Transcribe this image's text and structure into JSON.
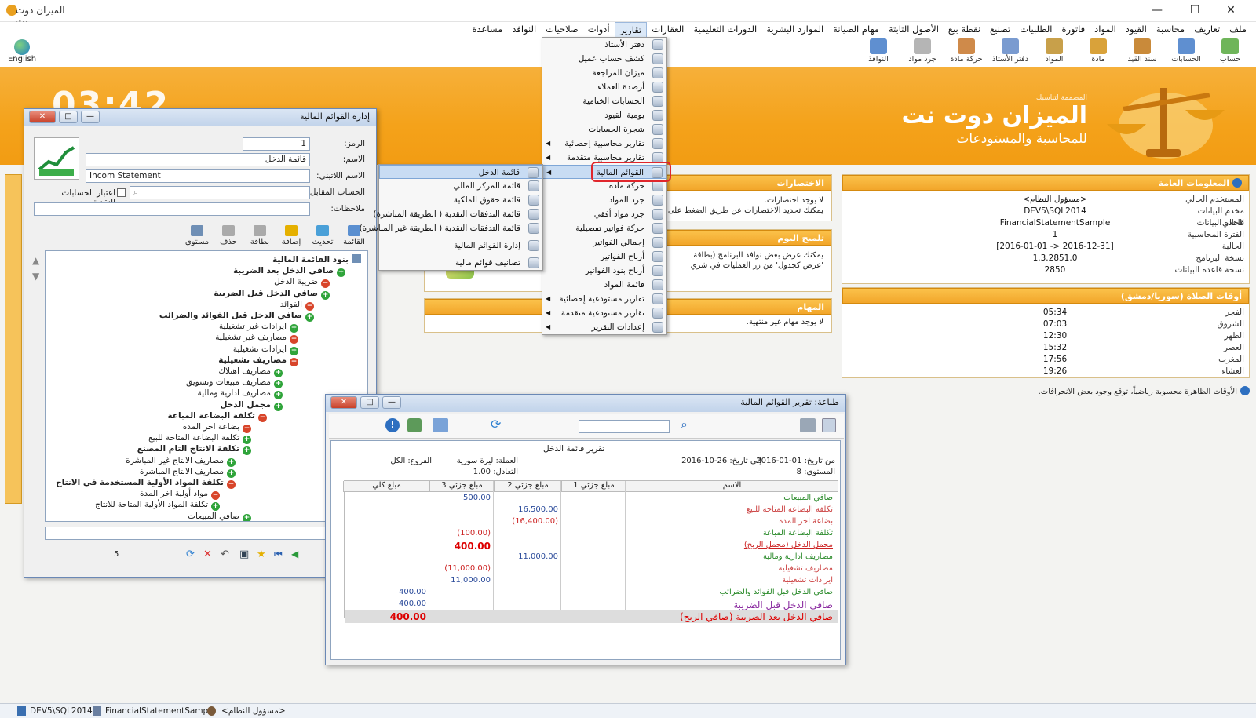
{
  "app": {
    "title": "الميزان دوت نت",
    "language_button": "English"
  },
  "menubar": [
    "ملف",
    "تعاريف",
    "محاسبة",
    "القيود",
    "المواد",
    "فاتورة",
    "الطلبيات",
    "تصنيع",
    "نقطة بيع",
    "الأصول الثابتة",
    "مهام الصيانة",
    "الموارد البشرية",
    "الدورات التعليمية",
    "العقارات",
    "تقارير",
    "أدوات",
    "صلاحيات",
    "النوافذ",
    "مساعدة"
  ],
  "toolbar": [
    "حساب",
    "الحسابات",
    "سند القيد",
    "مادة",
    "المواد",
    "دفتر الأستاذ",
    "حركة مادة",
    "جرد مواد",
    "النوافذ"
  ],
  "banner": {
    "clock": "03:42",
    "company_small": "المصممة لتناسبك",
    "brand": "الميزان دوت نت",
    "tagline": "للمحاسبة والمستودعات"
  },
  "general_info": {
    "title": "المعلومات العامة",
    "rows": [
      {
        "k": "المستخدم الحالي",
        "v": "<مسؤول النظام>"
      },
      {
        "k": "مخدم البيانات الحالي",
        "v": "DEV5\\SQL2014"
      },
      {
        "k": "قاعدة البيانات",
        "v": "FinancialStatementSample"
      },
      {
        "k": "الفترة المحاسبية الحالية",
        "v": "1"
      },
      {
        "k": "",
        "v": "[2016-12-31 <- 2016-01-01]"
      },
      {
        "k": "نسخة البرنامج",
        "v": "1.3.2851.0"
      },
      {
        "k": "نسخة قاعدة البيانات",
        "v": "2850"
      }
    ]
  },
  "prayer": {
    "title": "أوقات الصلاة (سوريا/دمشق)",
    "rows": [
      {
        "k": "الفجر",
        "v": "05:34"
      },
      {
        "k": "الشروق",
        "v": "07:03"
      },
      {
        "k": "الظهر",
        "v": "12:30"
      },
      {
        "k": "العصر",
        "v": "15:32"
      },
      {
        "k": "المغرب",
        "v": "17:56"
      },
      {
        "k": "العشاء",
        "v": "19:26"
      }
    ],
    "note": "الأوقات الظاهرة محسوبة رياضياً، توقع وجود بعض الانحرافات."
  },
  "shortcuts": {
    "title": "الاختصارات",
    "line1": "لا يوجد اختصارات.",
    "line2": "يمكنك تحديد الاختصارات عن طريق الضغط على زر"
  },
  "tip": {
    "title": "تلميح اليوم",
    "line1": "يمكنك عرض بعض نوافذ البرنامج (بطاقة",
    "line2": "'عرض كجدول' من زر العمليات في شري"
  },
  "tasks": {
    "title": "المهام",
    "line1": "لا يوجد مهام غير منتهية."
  },
  "reports_menu": {
    "items": [
      "دفتر الأستاذ",
      "كشف حساب عميل",
      "ميزان المراجعة",
      "أرصدة العملاء",
      "الحسابات الختامية",
      "يومية القيود",
      "شجرة الحسابات",
      "تقارير محاسبية إحصائية",
      "تقارير محاسبية متقدمة",
      "القوائم المالية",
      "حركة مادة",
      "جرد المواد",
      "جرد مواد أفقي",
      "حركة فواتير تفصيلية",
      "إجمالي الفواتير",
      "أرباح الفواتير",
      "أرباح بنود الفواتير",
      "قائمة المواد",
      "تقارير مستودعية إحصائية",
      "تقارير مستودعية متقدمة",
      "إعدادات التقرير"
    ]
  },
  "submenu": {
    "items": [
      "قائمة الدخل",
      "قائمة المركز المالي",
      "قائمة حقوق الملكية",
      "قائمة التدفقات النقدية ( الطريقة المباشرة)",
      "قائمة التدفقات النقدية ( الطريقة غير المباشرة)",
      "إدارة القوائم المالية",
      "تصانيف قوائم مالية"
    ]
  },
  "fs_window": {
    "title": "إدارة القوائم المالية",
    "code_label": "الرمز:",
    "code_value": "1",
    "name_label": "الاسم:",
    "name_value": "قائمة الدخل",
    "latin_label": "الاسم اللاتيني:",
    "latin_value": "Incom Statement",
    "contra_label": "الحساب المقابل:",
    "cash_label": "اعتبار الحسابات النقدية",
    "notes_label": "ملاحظات:",
    "tools": [
      "القائمة",
      "تحديث",
      "إضافة",
      "بطاقة",
      "حذف",
      "مستوى"
    ],
    "tree": [
      {
        "t": "بنود القائمة المالية",
        "b": true,
        "i": ""
      },
      {
        "t": "صافي الدخل بعد الضريبة",
        "b": true,
        "i": "g"
      },
      {
        "t": "ضريبة الدخل",
        "b": false,
        "i": "r"
      },
      {
        "t": "صافي الدخل قبل الضريبة",
        "b": true,
        "i": "g"
      },
      {
        "t": "الفوائد",
        "b": false,
        "i": "r"
      },
      {
        "t": "صافي الدخل قبل الفوائد والضرائب",
        "b": true,
        "i": "g"
      },
      {
        "t": "ايرادات غير تشغيلية",
        "b": false,
        "i": "g"
      },
      {
        "t": "مصاريف غير تشغيلية",
        "b": false,
        "i": "r"
      },
      {
        "t": "ايرادات تشغيلية",
        "b": false,
        "i": "g"
      },
      {
        "t": "مصاريف تشغيلية",
        "b": true,
        "i": "r"
      },
      {
        "t": "مصاريف اهتلاك",
        "b": false,
        "i": "g"
      },
      {
        "t": "مصاريف مبيعات وتسويق",
        "b": false,
        "i": "g"
      },
      {
        "t": "مصاريف ادارية ومالية",
        "b": false,
        "i": "g"
      },
      {
        "t": "مجمل الدخل",
        "b": true,
        "i": "g"
      },
      {
        "t": "تكلفة البضاعة المباعة",
        "b": true,
        "i": "r"
      },
      {
        "t": "بضاعة اخر المدة",
        "b": false,
        "i": "r"
      },
      {
        "t": "تكلفة البضاعة المتاحة للبيع",
        "b": false,
        "i": "g"
      },
      {
        "t": "تكلفة الانتاج التام المصنع",
        "b": true,
        "i": "g"
      },
      {
        "t": "مصاريف الانتاج غير المباشرة",
        "b": false,
        "i": "g"
      },
      {
        "t": "مصاريف الانتاج المباشرة",
        "b": false,
        "i": "g"
      },
      {
        "t": "تكلفة المواد الأولية المستخدمة في الانتاج",
        "b": true,
        "i": "r"
      },
      {
        "t": "مواد أولية اخر المدة",
        "b": false,
        "i": "r"
      },
      {
        "t": "تكلفة المواد الأولية المتاحة للانتاج",
        "b": false,
        "i": "g"
      },
      {
        "t": "صافي المبيعات",
        "b": false,
        "i": "g"
      }
    ],
    "level": "5"
  },
  "print_window": {
    "title": "طباعة: تقرير القوائم المالية",
    "report_title": "تقرير قائمة الدخل",
    "from_label": "من تاريخ:",
    "from": "01-01-2016",
    "to_label": "إلى تاريخ:",
    "to": "26-10-2016",
    "level_label": "المستوى:",
    "level": "8",
    "currency_label": "العملة:",
    "currency": "ليرة سورية",
    "rate_label": "التعادل:",
    "rate": "1.00",
    "branches_label": "الفروع:",
    "branches": "الكل",
    "headers": [
      "الاسم",
      "مبلغ جزئي 1",
      "مبلغ جزئي 2",
      "مبلغ جزئي 3",
      "مبلغ كلي"
    ],
    "rows": [
      {
        "name": "صافي المبيعات",
        "p1": "",
        "p2": "",
        "p3": "500.00",
        "total": ""
      },
      {
        "name": "تكلفة البضاعة المتاحة للبيع",
        "p1": "",
        "p2": "16,500.00",
        "p3": "",
        "total": ""
      },
      {
        "name": "بضاعة اخر المدة",
        "p1": "",
        "p2": "(16,400.00)",
        "p3": "",
        "total": ""
      },
      {
        "name": "تكلفة البضاعة المباعة",
        "p1": "",
        "p2": "",
        "p3": "(100.00)",
        "total": ""
      },
      {
        "name": "مجمل الدخل (مجمل الربح)",
        "p1": "",
        "p2": "",
        "p3": "400.00",
        "total": ""
      },
      {
        "name": "مصاريف ادارية ومالية",
        "p1": "",
        "p2": "11,000.00",
        "p3": "",
        "total": ""
      },
      {
        "name": "مصاريف تشغيلية",
        "p1": "",
        "p2": "",
        "p3": "(11,000.00)",
        "total": ""
      },
      {
        "name": "ايرادات تشغيلية",
        "p1": "",
        "p2": "",
        "p3": "11,000.00",
        "total": ""
      },
      {
        "name": "صافي الدخل قبل الفوائد والضرائب",
        "p1": "",
        "p2": "",
        "p3": "",
        "total": "400.00"
      },
      {
        "name": "صافي الدخل قبل الضريبة",
        "p1": "",
        "p2": "",
        "p3": "",
        "total": "400.00"
      },
      {
        "name": "صافي الدخل بعد الضريبة (صافي الربح)",
        "p1": "",
        "p2": "",
        "p3": "",
        "total": "400.00"
      }
    ]
  },
  "statusbar": {
    "server": "DEV5\\SQL2014",
    "db": "FinancialStatementSample",
    "user": "<مسؤول النظام>"
  }
}
